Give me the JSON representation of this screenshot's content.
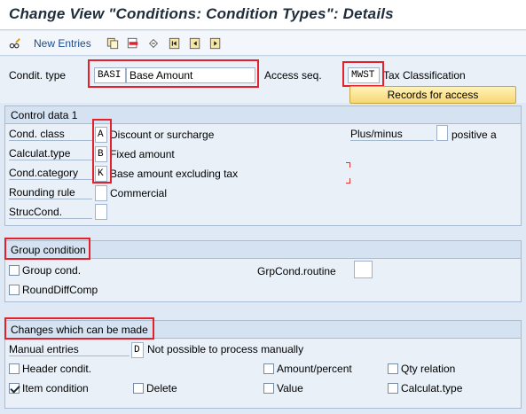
{
  "title": "Change View \"Conditions: Condition Types\": Details",
  "toolbar": {
    "new_entries": "New Entries",
    "icons": [
      "pencil-glasses-icon",
      "copy-icon",
      "delete-icon",
      "undo-icon",
      "first-page-icon",
      "previous-page-icon",
      "next-page-icon"
    ]
  },
  "header": {
    "condit_type_label": "Condit. type",
    "condit_type_code": "BASI",
    "condit_type_desc": "Base Amount",
    "access_seq_label": "Access seq.",
    "access_seq_code": "MWST",
    "access_seq_desc": "Tax Classification",
    "records_button": "Records for access"
  },
  "control_data": {
    "title": "Control data 1",
    "cond_class_label": "Cond. class",
    "cond_class_code": "A",
    "cond_class_desc": "Discount or surcharge",
    "calculat_type_label": "Calculat.type",
    "calculat_type_code": "B",
    "calculat_type_desc": "Fixed amount",
    "cond_category_label": "Cond.category",
    "cond_category_code": "K",
    "cond_category_desc": "Base amount excluding tax",
    "rounding_rule_label": "Rounding rule",
    "rounding_rule_desc": "Commercial",
    "struc_cond_label": "StrucCond.",
    "plus_minus_label": "Plus/minus",
    "plus_minus_desc": "positive a"
  },
  "group_condition": {
    "title": "Group condition",
    "group_cond_label": "Group cond.",
    "round_diff_label": "RoundDiffComp",
    "grp_routine_label": "GrpCond.routine"
  },
  "changes": {
    "title": "Changes which can be made",
    "manual_entries_label": "Manual entries",
    "manual_entries_code": "D",
    "manual_entries_desc": "Not possible to process manually",
    "header_condit_label": "Header condit.",
    "amount_percent_label": "Amount/percent",
    "qty_relation_label": "Qty relation",
    "item_condition_label": "Item condition",
    "item_condition_checked": true,
    "delete_label": "Delete",
    "value_label": "Value",
    "calculat_type_label": "Calculat.type"
  },
  "colors": {
    "highlight": "#e4202a",
    "button_yellow": "#f7d774",
    "link_blue": "#1a4b8c"
  }
}
